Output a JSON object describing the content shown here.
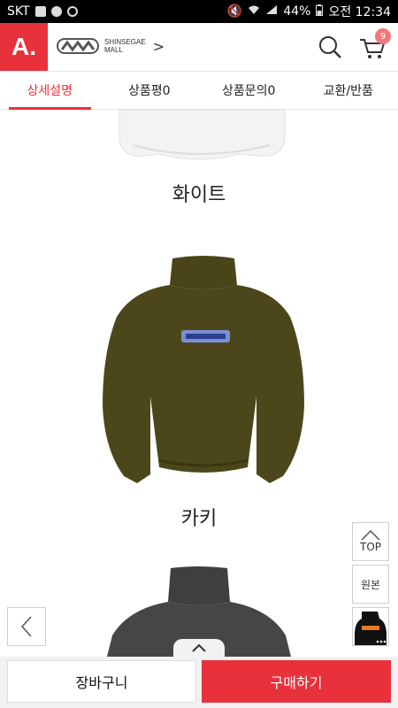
{
  "status": {
    "carrier": "SKT",
    "battery": "44%",
    "time": "오전 12:34"
  },
  "header": {
    "logo": "A.",
    "mall_line1": "SHINSEGAE",
    "mall_line2": "MALL",
    "mall_arrow": ">",
    "cart_count": "9"
  },
  "tabs": [
    {
      "label": "상세설명"
    },
    {
      "label": "상품평0"
    },
    {
      "label": "상품문의0"
    },
    {
      "label": "교환/반품"
    }
  ],
  "products": [
    {
      "caption": "화이트",
      "color": "#f4f4f4"
    },
    {
      "caption": "카키",
      "color": "#4a4518"
    },
    {
      "caption": "",
      "color": "#3f3f3f"
    }
  ],
  "floating": {
    "top_label": "TOP",
    "original_label": "원본"
  },
  "bottom": {
    "cart_label": "장바구니",
    "buy_label": "구매하기"
  },
  "colors": {
    "brand_red": "#e8313b",
    "badge_pink": "#f2767d"
  }
}
